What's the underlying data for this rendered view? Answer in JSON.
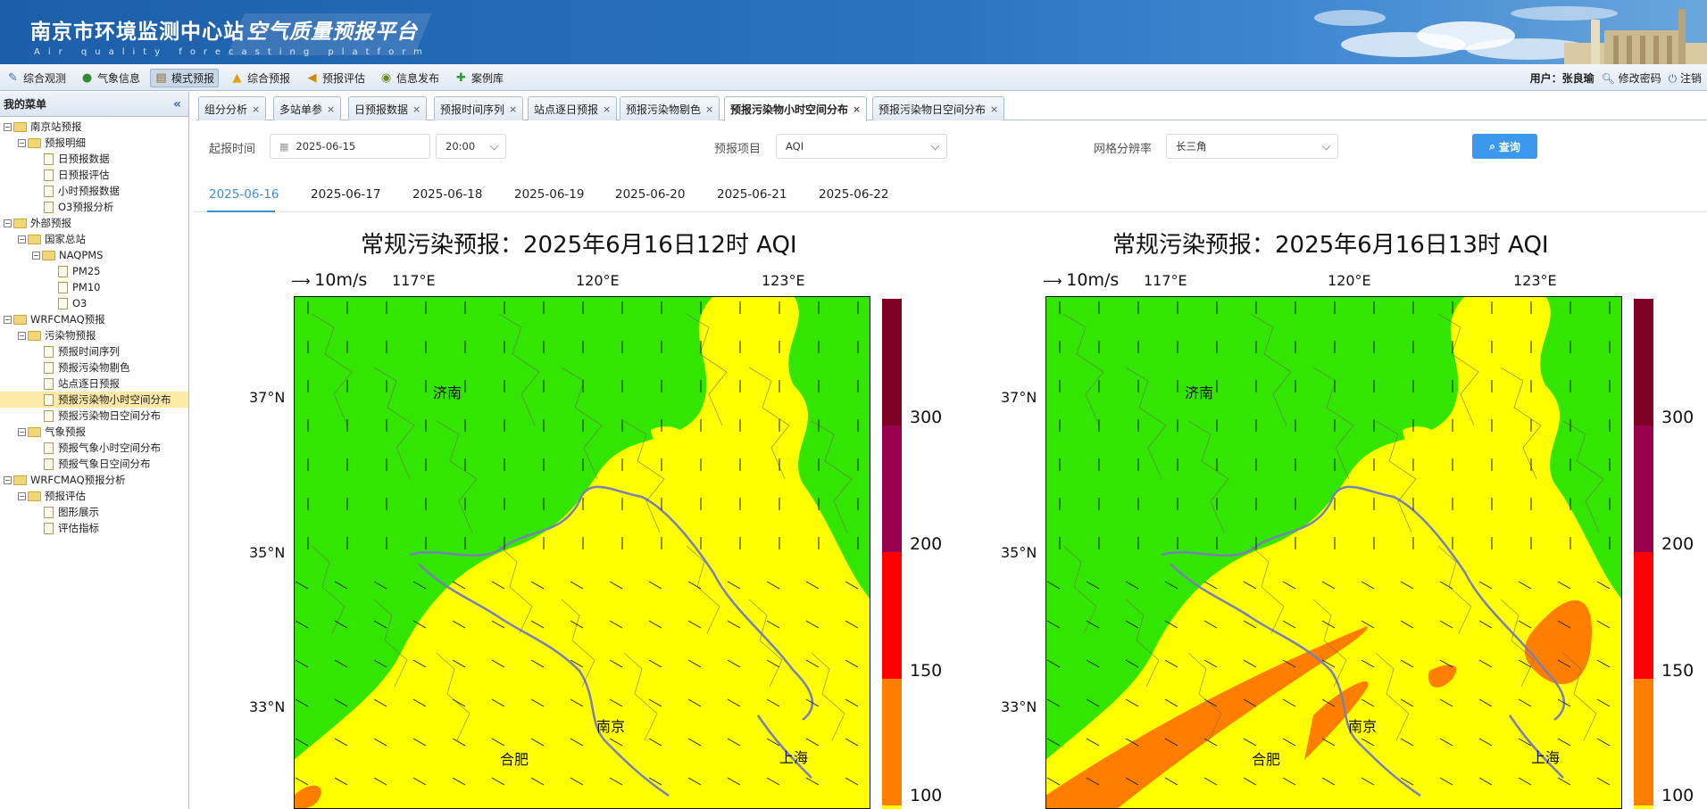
{
  "header": {
    "title_cn": "南京市环境监测中心站",
    "title_platform": "空气质量预报平台",
    "title_en": "Air quality forecasting platform"
  },
  "toolbar": {
    "items": [
      {
        "label": "综合观测",
        "icon": "observation-icon"
      },
      {
        "label": "气象信息",
        "icon": "globe-icon"
      },
      {
        "label": "模式预报",
        "icon": "clipboard-icon"
      },
      {
        "label": "综合预报",
        "icon": "warning-icon"
      },
      {
        "label": "预报评估",
        "icon": "speaker-icon"
      },
      {
        "label": "信息发布",
        "icon": "broadcast-icon"
      },
      {
        "label": "案例库",
        "icon": "puzzle-icon"
      }
    ],
    "active_index": 2,
    "user_label": "用户：张良瑜",
    "change_password": "修改密码",
    "logout": "注销"
  },
  "sidebar": {
    "header": "我的菜单",
    "tree": [
      {
        "label": "南京站预报",
        "level": 0,
        "type": "folder"
      },
      {
        "label": "预报明细",
        "level": 1,
        "type": "folder"
      },
      {
        "label": "日预报数据",
        "level": 2,
        "type": "doc"
      },
      {
        "label": "日预报评估",
        "level": 2,
        "type": "doc"
      },
      {
        "label": "小时预报数据",
        "level": 2,
        "type": "doc"
      },
      {
        "label": "O3预报分析",
        "level": 2,
        "type": "doc"
      },
      {
        "label": "外部预报",
        "level": 0,
        "type": "folder"
      },
      {
        "label": "国家总站",
        "level": 1,
        "type": "folder"
      },
      {
        "label": "NAQPMS",
        "level": 2,
        "type": "folder"
      },
      {
        "label": "PM25",
        "level": 3,
        "type": "doc"
      },
      {
        "label": "PM10",
        "level": 3,
        "type": "doc"
      },
      {
        "label": "O3",
        "level": 3,
        "type": "doc"
      },
      {
        "label": "WRFCMAQ预报",
        "level": 0,
        "type": "folder"
      },
      {
        "label": "污染物预报",
        "level": 1,
        "type": "folder"
      },
      {
        "label": "预报时间序列",
        "level": 2,
        "type": "doc"
      },
      {
        "label": "预报污染物剔色",
        "level": 2,
        "type": "doc"
      },
      {
        "label": "站点逐日预报",
        "level": 2,
        "type": "doc"
      },
      {
        "label": "预报污染物小时空间分布",
        "level": 2,
        "type": "doc",
        "selected": true
      },
      {
        "label": "预报污染物日空间分布",
        "level": 2,
        "type": "doc"
      },
      {
        "label": "气象预报",
        "level": 1,
        "type": "folder"
      },
      {
        "label": "预报气象小时空间分布",
        "level": 2,
        "type": "doc"
      },
      {
        "label": "预报气象日空间分布",
        "level": 2,
        "type": "doc"
      },
      {
        "label": "WRFCMAQ预报分析",
        "level": 0,
        "type": "folder"
      },
      {
        "label": "预报评估",
        "level": 1,
        "type": "folder"
      },
      {
        "label": "图形展示",
        "level": 2,
        "type": "doc"
      },
      {
        "label": "评估指标",
        "level": 2,
        "type": "doc"
      }
    ]
  },
  "tabs": [
    {
      "label": "组分分析"
    },
    {
      "label": "多站单参"
    },
    {
      "label": "日预报数据"
    },
    {
      "label": "预报时间序列"
    },
    {
      "label": "站点逐日预报"
    },
    {
      "label": "预报污染物剔色"
    },
    {
      "label": "预报污染物小时空间分布",
      "active": true
    },
    {
      "label": "预报污染物日空间分布"
    }
  ],
  "form": {
    "start_time_label": "起报时间",
    "start_date": "2025-06-15",
    "start_hour": "20:00",
    "item_label": "预报项目",
    "item_value": "AQI",
    "grid_label": "网格分辨率",
    "grid_value": "长三角",
    "query_button": "查询"
  },
  "date_tabs": [
    "2025-06-16",
    "2025-06-17",
    "2025-06-18",
    "2025-06-19",
    "2025-06-20",
    "2025-06-21",
    "2025-06-22"
  ],
  "maps": [
    {
      "title": "常规污染预报：2025年6月16日12时 AQI"
    },
    {
      "title": "常规污染预报：2025年6月16日13时 AQI"
    }
  ],
  "map_common": {
    "wind_label": "10m/s",
    "lon_ticks": [
      "117°E",
      "120°E",
      "123°E"
    ],
    "lat_ticks": [
      "37°N",
      "35°N",
      "33°N"
    ],
    "cities": [
      "济南",
      "南京",
      "合肥",
      "上海"
    ],
    "colorbar_ticks": [
      "300",
      "200",
      "150",
      "100"
    ],
    "colors": {
      "good": "#33e600",
      "moderate": "#ffff00",
      "light": "#ff7e00",
      "medium": "#ff0000",
      "heavy": "#99004c",
      "severe": "#7e0023"
    }
  }
}
